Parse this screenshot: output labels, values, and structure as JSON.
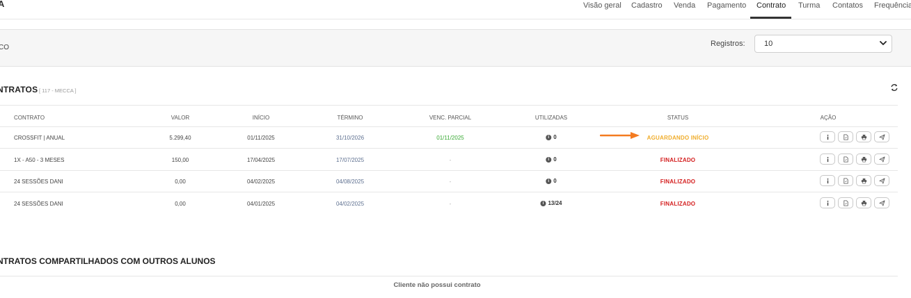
{
  "brand": {
    "text": "A"
  },
  "nav": {
    "items": [
      {
        "label": "Visão geral"
      },
      {
        "label": "Cadastro"
      },
      {
        "label": "Venda"
      },
      {
        "label": "Pagamento"
      },
      {
        "label": "Contrato",
        "active": true
      },
      {
        "label": "Turma"
      },
      {
        "label": "Contatos"
      },
      {
        "label": "Frequência"
      }
    ]
  },
  "filter": {
    "cut_text": "CO",
    "registros_label": "Registros:",
    "registros_value": "10"
  },
  "contracts": {
    "title": "NTRATOS",
    "subtitle": "[ 117 - MECCA ]",
    "columns": [
      "CONTRATO",
      "VALOR",
      "INÍCIO",
      "TÉRMINO",
      "VENC. PARCIAL",
      "UTILIZADAS",
      "STATUS",
      "AÇÃO"
    ],
    "rows": [
      {
        "contrato": "CROSSFIT | ANUAL",
        "valor": "5.299,40",
        "inicio": "01/11/2025",
        "termino": "31/10/2026",
        "venc": "01/11/2025",
        "utilizadas": "0",
        "status": "AGUARDANDO INÍCIO"
      },
      {
        "contrato": "1X - A50 - 3 MESES",
        "valor": "150,00",
        "inicio": "17/04/2025",
        "termino": "17/07/2025",
        "venc": "-",
        "utilizadas": "0",
        "status": "FINALIZADO"
      },
      {
        "contrato": "24 SESSÕES DANI",
        "valor": "0,00",
        "inicio": "04/02/2025",
        "termino": "04/08/2025",
        "venc": "-",
        "utilizadas": "0",
        "status": "FINALIZADO"
      },
      {
        "contrato": "24 SESSÕES DANI",
        "valor": "0,00",
        "inicio": "04/01/2025",
        "termino": "04/02/2025",
        "venc": "-",
        "utilizadas": "13/24",
        "status": "FINALIZADO"
      }
    ]
  },
  "shared": {
    "title": "NTRATOS COMPARTILHADOS COM OUTROS ALUNOS",
    "empty": "Cliente não possui contrato"
  },
  "colors": {
    "status_waiting": "#f0ad2c",
    "status_finished": "#d42020",
    "arrow": "#f47b20",
    "venc_green": "#3aaa35"
  }
}
